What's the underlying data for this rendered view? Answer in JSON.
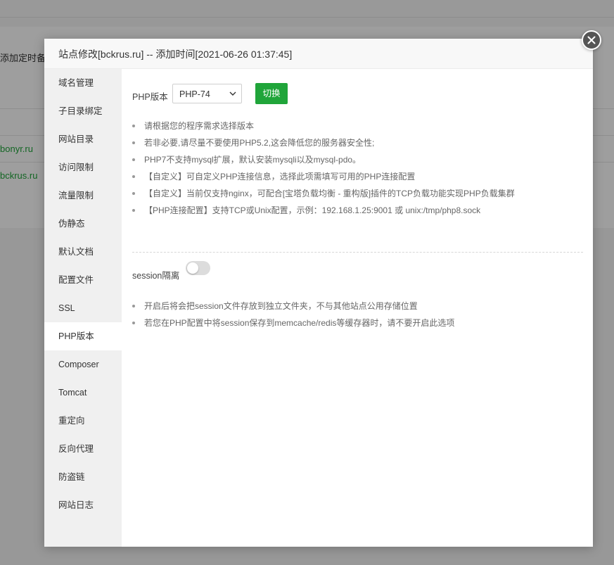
{
  "background": {
    "toolbar_text": "添加定时备份",
    "rows": [
      "bonyr.ru",
      "bckrus.ru"
    ]
  },
  "modal": {
    "title": "站点修改[bckrus.ru] -- 添加时间[2021-06-26 01:37:45]",
    "close_icon": "close-icon"
  },
  "sidebar": {
    "active_index": 9,
    "items": [
      {
        "label": "域名管理"
      },
      {
        "label": "子目录绑定"
      },
      {
        "label": "网站目录"
      },
      {
        "label": "访问限制"
      },
      {
        "label": "流量限制"
      },
      {
        "label": "伪静态"
      },
      {
        "label": "默认文档"
      },
      {
        "label": "配置文件"
      },
      {
        "label": "SSL"
      },
      {
        "label": "PHP版本"
      },
      {
        "label": "Composer"
      },
      {
        "label": "Tomcat"
      },
      {
        "label": "重定向"
      },
      {
        "label": "反向代理"
      },
      {
        "label": "防盗链"
      },
      {
        "label": "网站日志"
      }
    ]
  },
  "php": {
    "label": "PHP版本",
    "selected": "PHP-74",
    "switch_label": "切换",
    "tips": [
      "请根据您的程序需求选择版本",
      "若非必要,请尽量不要使用PHP5.2,这会降低您的服务器安全性;",
      "PHP7不支持mysql扩展，默认安装mysqli以及mysql-pdo。",
      "【自定义】可自定义PHP连接信息，选择此项需填写可用的PHP连接配置",
      "【自定义】当前仅支持nginx，可配合[宝塔负载均衡 - 重构版]插件的TCP负载功能实现PHP负载集群",
      "【PHP连接配置】支持TCP或Unix配置，示例：192.168.1.25:9001 或 unix:/tmp/php8.sock"
    ]
  },
  "session": {
    "label": "session隔离",
    "enabled": false,
    "tips": [
      "开启后将会把session文件存放到独立文件夹，不与其他站点公用存储位置",
      "若您在PHP配置中将session保存到memcache/redis等缓存器时，请不要开启此选项"
    ]
  },
  "colors": {
    "accent": "#20a53a",
    "sidebar_bg": "#f0f0f0",
    "active_bg": "#ffffff"
  }
}
